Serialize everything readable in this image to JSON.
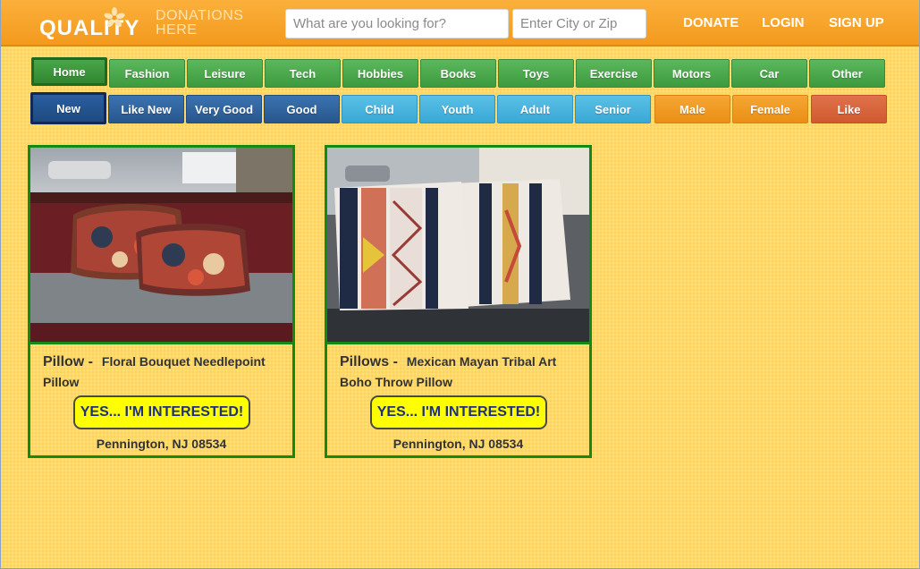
{
  "header": {
    "logo_main": "QUALITY",
    "logo_sub_line1": "DONATIONS",
    "logo_sub_line2": "HERE",
    "search_placeholder": "What are you looking for?",
    "city_placeholder": "Enter City or Zip",
    "nav": {
      "donate": "DONATE",
      "login": "LOGIN",
      "signup": "SIGN UP"
    }
  },
  "categories": [
    "Home",
    "Fashion",
    "Leisure",
    "Tech",
    "Hobbies",
    "Books",
    "Toys",
    "Exercise",
    "Motors",
    "Car",
    "Other"
  ],
  "filters": [
    "New",
    "Like New",
    "Very Good",
    "Good",
    "Child",
    "Youth",
    "Adult",
    "Senior",
    "Male",
    "Female",
    "Like"
  ],
  "active_category": "Home",
  "active_filter": "New",
  "listings": [
    {
      "category": "Pillow -",
      "description": "Floral Bouquet Needlepoint Pillow",
      "button": "YES... I'M INTERESTED!",
      "location": "Pennington, NJ 08534"
    },
    {
      "category": "Pillows -",
      "description": "Mexican Mayan Tribal Art Boho Throw Pillow",
      "button": "YES... I'M INTERESTED!",
      "location": "Pennington, NJ 08534"
    }
  ],
  "colors": {
    "header": "#f39a1e",
    "page_bg": "#ffd966",
    "card_border": "#138a13",
    "button_yellow": "#ffff00"
  }
}
